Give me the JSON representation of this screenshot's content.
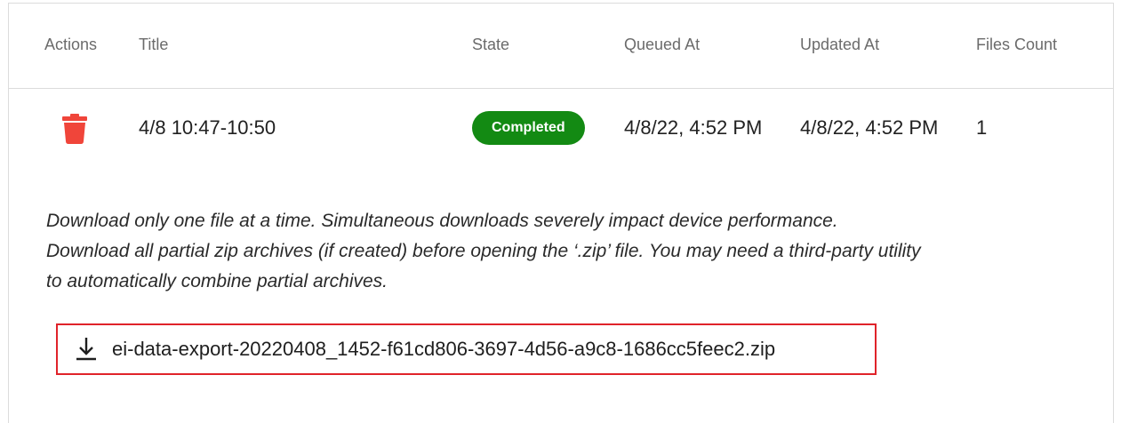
{
  "table": {
    "headers": {
      "actions": "Actions",
      "title": "Title",
      "state": "State",
      "queued_at": "Queued At",
      "updated_at": "Updated At",
      "files_count": "Files Count"
    },
    "rows": [
      {
        "action_icon": "trash-icon",
        "title": "4/8 10:47-10:50",
        "state": "Completed",
        "queued_at": "4/8/22, 4:52 PM",
        "updated_at": "4/8/22, 4:52 PM",
        "files_count": "1"
      }
    ]
  },
  "notice": {
    "line1": "Download only one file at a time. Simultaneous downloads severely impact device performance.",
    "line2": "Download all partial zip archives (if created) before opening the ‘.zip’ file. You may need a third-party utility",
    "line3": "to automatically combine partial archives."
  },
  "download": {
    "icon": "download-icon",
    "filename": "ei-data-export-20220408_1452-f61cd806-3697-4d56-a9c8-1686cc5feec2.zip"
  },
  "colors": {
    "delete": "#f0453a",
    "badge_completed": "#138a13",
    "highlight_border": "#e0232a",
    "header_text": "#6b6b6b"
  }
}
